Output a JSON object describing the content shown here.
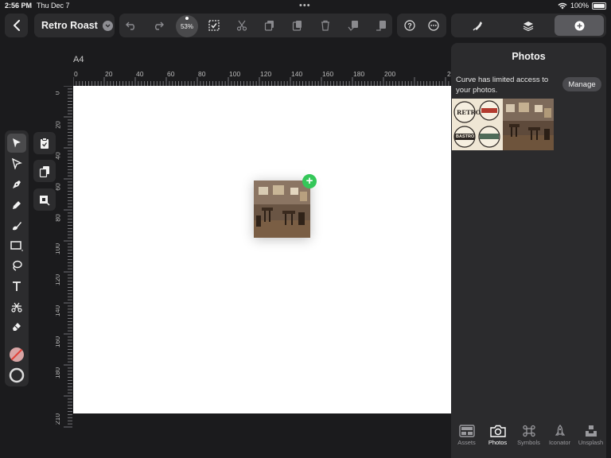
{
  "status_bar": {
    "time": "2:56 PM",
    "date": "Thu Dec 7",
    "battery": "100%"
  },
  "toolbar": {
    "doc_title": "Retro Roast",
    "zoom": "53%"
  },
  "canvas": {
    "page_label": "A4",
    "ruler_top": [
      "0",
      "20",
      "40",
      "60",
      "80",
      "100",
      "120",
      "140",
      "160",
      "180",
      "200",
      "2"
    ],
    "ruler_left": [
      "0",
      "20",
      "40",
      "60",
      "80",
      "100",
      "120",
      "140",
      "160",
      "180",
      "210"
    ]
  },
  "panel": {
    "title": "Photos",
    "notice": "Curve has limited access to your photos.",
    "manage_label": "Manage",
    "tabs": [
      {
        "label": "Assets",
        "icon": "assets-icon"
      },
      {
        "label": "Photos",
        "icon": "camera-icon"
      },
      {
        "label": "Symbols",
        "icon": "command-icon"
      },
      {
        "label": "Iconator",
        "icon": "rocket-icon"
      },
      {
        "label": "Unsplash",
        "icon": "unsplash-icon"
      }
    ]
  },
  "thumb_labels": {
    "retro": "RETRO",
    "bastro": "BASTRO"
  },
  "colors": {
    "accent_green": "#34c759",
    "panel_bg": "#2b2b2d",
    "app_bg": "#1b1b1d"
  }
}
